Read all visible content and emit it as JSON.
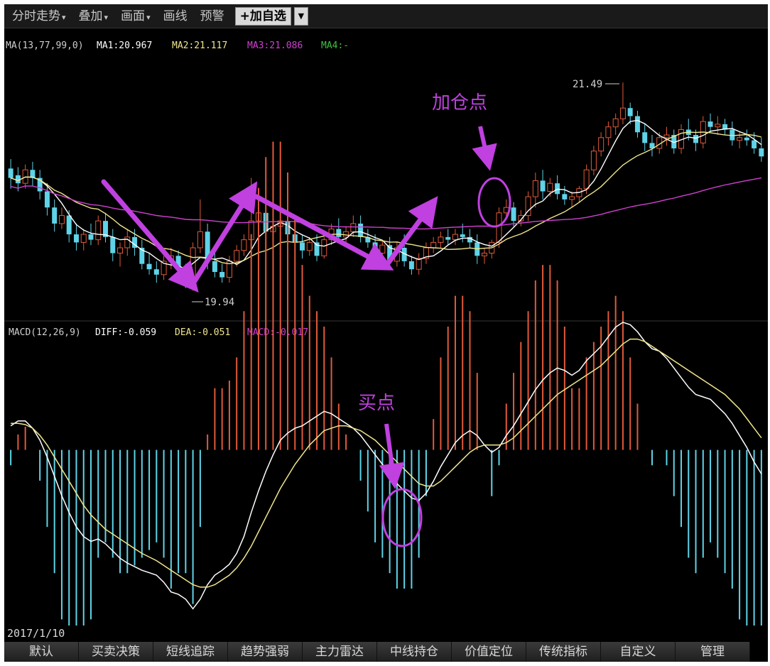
{
  "toolbar": {
    "items": [
      "分时走势",
      "叠加",
      "画面",
      "画线",
      "预警"
    ],
    "has_caret": [
      true,
      true,
      true,
      false,
      false
    ],
    "add_button": "+加自选",
    "dropdown": "▼"
  },
  "legend_price": {
    "ma_params": "MA(13,77,99,0)",
    "ma1": "MA1:20.967",
    "ma2": "MA2:21.117",
    "ma3": "MA3:21.086",
    "ma4": "MA4:-",
    "colors": {
      "ma1": "#ffffff",
      "ma2": "#f0e68c",
      "ma3": "#d040d0",
      "ma4": "#40c040"
    }
  },
  "legend_macd": {
    "params": "MACD(12,26,9)",
    "diff": "DIFF:-0.059",
    "dea": "DEA:-0.051",
    "macd": "MACD:-0.017",
    "colors": {
      "diff": "#ffffff",
      "dea": "#f0e68c",
      "macd": "#d040d0"
    }
  },
  "annotations": {
    "high_label": "21.49",
    "low_label": "19.94",
    "add_point": "加仓点",
    "buy_point": "买点"
  },
  "colors": {
    "up": "#e05a3a",
    "down": "#5fd3e8",
    "annotation": "#c040e0",
    "background": "#000000"
  },
  "date": "2017/1/10",
  "tabs": [
    "默认",
    "买卖决策",
    "短线追踪",
    "趋势强弱",
    "主力雷达",
    "中线持仓",
    "价值定位",
    "传统指标",
    "自定义",
    "管理"
  ],
  "chart_data": [
    {
      "type": "candlestick",
      "high_marker": 21.49,
      "low_marker": 19.94,
      "ylim": [
        19.8,
        21.65
      ],
      "ohlc": [
        [
          20.85,
          20.92,
          20.7,
          20.78
        ],
        [
          20.8,
          20.86,
          20.68,
          20.74
        ],
        [
          20.74,
          20.88,
          20.7,
          20.84
        ],
        [
          20.84,
          20.9,
          20.72,
          20.78
        ],
        [
          20.78,
          20.84,
          20.62,
          20.68
        ],
        [
          20.68,
          20.74,
          20.5,
          20.56
        ],
        [
          20.56,
          20.62,
          20.38,
          20.44
        ],
        [
          20.44,
          20.56,
          20.4,
          20.5
        ],
        [
          20.5,
          20.54,
          20.3,
          20.36
        ],
        [
          20.36,
          20.44,
          20.24,
          20.3
        ],
        [
          20.3,
          20.4,
          20.24,
          20.36
        ],
        [
          20.36,
          20.44,
          20.28,
          20.32
        ],
        [
          20.32,
          20.5,
          20.28,
          20.46
        ],
        [
          20.46,
          20.52,
          20.3,
          20.34
        ],
        [
          20.34,
          20.4,
          20.16,
          20.22
        ],
        [
          20.22,
          20.3,
          20.12,
          20.26
        ],
        [
          20.26,
          20.4,
          20.2,
          20.34
        ],
        [
          20.34,
          20.4,
          20.2,
          20.26
        ],
        [
          20.26,
          20.32,
          20.1,
          20.14
        ],
        [
          20.14,
          20.22,
          20.06,
          20.1
        ],
        [
          20.1,
          20.16,
          20.0,
          20.06
        ],
        [
          20.06,
          20.2,
          20.02,
          20.16
        ],
        [
          20.16,
          20.26,
          20.1,
          20.2
        ],
        [
          20.2,
          20.24,
          20.06,
          20.1
        ],
        [
          20.1,
          20.14,
          19.96,
          20.0
        ],
        [
          20.0,
          20.3,
          19.94,
          20.26
        ],
        [
          20.26,
          20.62,
          20.22,
          20.38
        ],
        [
          20.38,
          20.44,
          20.1,
          20.16
        ],
        [
          20.16,
          20.24,
          20.04,
          20.08
        ],
        [
          20.08,
          20.14,
          20.0,
          20.04
        ],
        [
          20.04,
          20.2,
          20.0,
          20.16
        ],
        [
          20.16,
          20.28,
          20.12,
          20.24
        ],
        [
          20.24,
          20.36,
          20.2,
          20.32
        ],
        [
          20.32,
          20.78,
          20.28,
          20.46
        ],
        [
          20.46,
          20.66,
          20.4,
          20.52
        ],
        [
          20.52,
          20.84,
          20.3,
          20.38
        ],
        [
          20.38,
          20.48,
          20.3,
          20.42
        ],
        [
          20.42,
          20.52,
          20.36,
          20.46
        ],
        [
          20.46,
          20.5,
          20.32,
          20.36
        ],
        [
          20.36,
          20.42,
          20.26,
          20.3
        ],
        [
          20.3,
          20.36,
          20.18,
          20.24
        ],
        [
          20.24,
          20.34,
          20.2,
          20.3
        ],
        [
          20.3,
          20.36,
          20.16,
          20.2
        ],
        [
          20.2,
          20.34,
          20.18,
          20.32
        ],
        [
          20.32,
          20.44,
          20.28,
          20.4
        ],
        [
          20.4,
          20.48,
          20.3,
          20.34
        ],
        [
          20.34,
          20.42,
          20.3,
          20.38
        ],
        [
          20.38,
          20.5,
          20.34,
          20.44
        ],
        [
          20.44,
          20.5,
          20.3,
          20.34
        ],
        [
          20.34,
          20.4,
          20.26,
          20.3
        ],
        [
          20.3,
          20.36,
          20.18,
          20.22
        ],
        [
          20.22,
          20.32,
          20.18,
          20.28
        ],
        [
          20.28,
          20.34,
          20.12,
          20.16
        ],
        [
          20.16,
          20.3,
          20.12,
          20.26
        ],
        [
          20.26,
          20.36,
          20.12,
          20.16
        ],
        [
          20.16,
          20.2,
          20.06,
          20.1
        ],
        [
          20.1,
          20.22,
          20.06,
          20.18
        ],
        [
          20.18,
          20.3,
          20.14,
          20.26
        ],
        [
          20.26,
          20.34,
          20.22,
          20.3
        ],
        [
          20.3,
          20.38,
          20.26,
          20.34
        ],
        [
          20.34,
          20.4,
          20.28,
          20.32
        ],
        [
          20.32,
          20.4,
          20.28,
          20.36
        ],
        [
          20.36,
          20.44,
          20.3,
          20.34
        ],
        [
          20.34,
          20.4,
          20.26,
          20.3
        ],
        [
          20.3,
          20.36,
          20.14,
          20.2
        ],
        [
          20.2,
          20.26,
          20.14,
          20.22
        ],
        [
          20.22,
          20.32,
          20.18,
          20.3
        ],
        [
          20.3,
          20.56,
          20.26,
          20.52
        ],
        [
          20.52,
          20.62,
          20.48,
          20.56
        ],
        [
          20.56,
          20.6,
          20.42,
          20.46
        ],
        [
          20.46,
          20.54,
          20.42,
          20.5
        ],
        [
          20.5,
          20.68,
          20.46,
          20.64
        ],
        [
          20.64,
          20.82,
          20.56,
          20.76
        ],
        [
          20.76,
          20.84,
          20.62,
          20.68
        ],
        [
          20.68,
          20.78,
          20.64,
          20.74
        ],
        [
          20.74,
          20.8,
          20.62,
          20.66
        ],
        [
          20.66,
          20.72,
          20.58,
          20.62
        ],
        [
          20.62,
          20.68,
          20.56,
          20.64
        ],
        [
          20.64,
          20.72,
          20.6,
          20.7
        ],
        [
          20.7,
          20.88,
          20.66,
          20.84
        ],
        [
          20.84,
          21.02,
          20.8,
          20.98
        ],
        [
          20.98,
          21.12,
          20.94,
          21.08
        ],
        [
          21.08,
          21.2,
          21.02,
          21.16
        ],
        [
          21.16,
          21.26,
          21.1,
          21.22
        ],
        [
          21.22,
          21.49,
          21.18,
          21.3
        ],
        [
          21.3,
          21.34,
          21.18,
          21.24
        ],
        [
          21.24,
          21.28,
          21.08,
          21.12
        ],
        [
          21.12,
          21.18,
          20.98,
          21.04
        ],
        [
          21.04,
          21.1,
          20.94,
          21.0
        ],
        [
          21.0,
          21.12,
          20.96,
          21.08
        ],
        [
          21.08,
          21.16,
          21.02,
          21.1
        ],
        [
          21.1,
          21.14,
          20.96,
          21.0
        ],
        [
          21.0,
          21.18,
          20.96,
          21.14
        ],
        [
          21.14,
          21.22,
          21.06,
          21.1
        ],
        [
          21.1,
          21.14,
          20.98,
          21.04
        ],
        [
          21.04,
          21.24,
          21.0,
          21.2
        ],
        [
          21.2,
          21.26,
          21.12,
          21.16
        ],
        [
          21.16,
          21.24,
          21.1,
          21.18
        ],
        [
          21.18,
          21.22,
          21.1,
          21.14
        ],
        [
          21.14,
          21.2,
          21.02,
          21.06
        ],
        [
          21.06,
          21.12,
          21.0,
          21.08
        ],
        [
          21.08,
          21.14,
          21.02,
          21.06
        ],
        [
          21.06,
          21.12,
          20.96,
          21.0
        ],
        [
          21.0,
          21.08,
          20.9,
          20.94
        ]
      ]
    },
    {
      "type": "line",
      "title": "MACD(12,26,9)",
      "ylim": [
        -0.14,
        0.09
      ],
      "series": [
        {
          "name": "DIFF",
          "values": [
            0.02,
            0.024,
            0.024,
            0.018,
            0.008,
            -0.006,
            -0.022,
            -0.038,
            -0.052,
            -0.064,
            -0.072,
            -0.076,
            -0.074,
            -0.078,
            -0.084,
            -0.09,
            -0.094,
            -0.097,
            -0.1,
            -0.102,
            -0.104,
            -0.11,
            -0.118,
            -0.12,
            -0.124,
            -0.132,
            -0.124,
            -0.112,
            -0.104,
            -0.1,
            -0.095,
            -0.086,
            -0.072,
            -0.052,
            -0.034,
            -0.018,
            -0.004,
            0.008,
            0.014,
            0.018,
            0.02,
            0.024,
            0.028,
            0.032,
            0.03,
            0.026,
            0.022,
            0.018,
            0.012,
            0.004,
            -0.004,
            -0.012,
            -0.02,
            -0.028,
            -0.034,
            -0.04,
            -0.042,
            -0.036,
            -0.026,
            -0.014,
            -0.004,
            0.006,
            0.012,
            0.016,
            0.012,
            0.004,
            -0.002,
            0.002,
            0.012,
            0.02,
            0.03,
            0.04,
            0.05,
            0.058,
            0.064,
            0.068,
            0.066,
            0.062,
            0.066,
            0.074,
            0.08,
            0.086,
            0.094,
            0.102,
            0.106,
            0.104,
            0.098,
            0.09,
            0.084,
            0.082,
            0.076,
            0.068,
            0.06,
            0.052,
            0.046,
            0.044,
            0.042,
            0.036,
            0.03,
            0.022,
            0.012,
            0.002,
            -0.01,
            -0.02
          ]
        },
        {
          "name": "DEA",
          "values": [
            0.022,
            0.022,
            0.021,
            0.018,
            0.012,
            0.004,
            -0.006,
            -0.016,
            -0.026,
            -0.036,
            -0.046,
            -0.054,
            -0.06,
            -0.066,
            -0.07,
            -0.074,
            -0.078,
            -0.082,
            -0.086,
            -0.089,
            -0.092,
            -0.096,
            -0.1,
            -0.104,
            -0.108,
            -0.112,
            -0.114,
            -0.114,
            -0.112,
            -0.108,
            -0.104,
            -0.098,
            -0.09,
            -0.08,
            -0.068,
            -0.056,
            -0.044,
            -0.032,
            -0.022,
            -0.012,
            -0.004,
            0.004,
            0.01,
            0.016,
            0.018,
            0.02,
            0.02,
            0.018,
            0.016,
            0.012,
            0.008,
            0.002,
            -0.004,
            -0.01,
            -0.016,
            -0.022,
            -0.028,
            -0.03,
            -0.03,
            -0.026,
            -0.02,
            -0.014,
            -0.008,
            -0.002,
            0.002,
            0.004,
            0.004,
            0.004,
            0.006,
            0.01,
            0.016,
            0.022,
            0.028,
            0.034,
            0.04,
            0.046,
            0.05,
            0.054,
            0.058,
            0.062,
            0.066,
            0.07,
            0.076,
            0.082,
            0.088,
            0.092,
            0.092,
            0.09,
            0.086,
            0.082,
            0.078,
            0.074,
            0.07,
            0.066,
            0.062,
            0.058,
            0.054,
            0.05,
            0.046,
            0.04,
            0.034,
            0.026,
            0.018,
            0.01
          ]
        }
      ]
    }
  ]
}
